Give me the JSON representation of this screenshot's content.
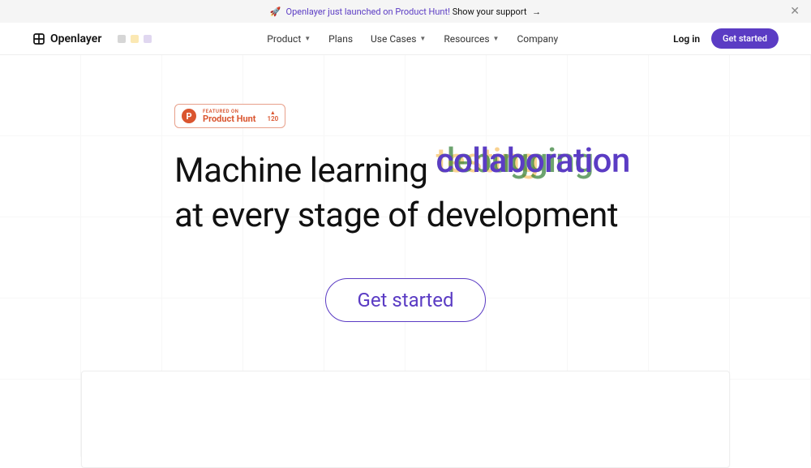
{
  "banner": {
    "textPurple": "Openlayer just launched on Product Hunt!",
    "textDark": "Show your support",
    "arrow": "→"
  },
  "header": {
    "brand": "Openlayer",
    "nav": {
      "product": "Product",
      "plans": "Plans",
      "useCases": "Use Cases",
      "resources": "Resources",
      "company": "Company"
    },
    "login": "Log in",
    "getStarted": "Get started"
  },
  "productHunt": {
    "featured": "FEATURED ON",
    "name": "Product Hunt",
    "upvotes": "120"
  },
  "hero": {
    "prefix": "Machine learning",
    "words": {
      "w1": "collaboration",
      "w2": "debugging",
      "w3": "testing"
    },
    "suffix": "at every stage of development",
    "cta": "Get started"
  }
}
